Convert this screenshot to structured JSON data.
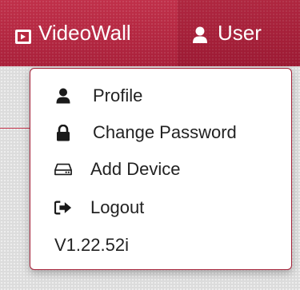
{
  "navbar": {
    "brand_label": "VideoWall",
    "brand_icon": "video-icon",
    "user_label": "User",
    "user_icon": "user-icon",
    "accent_color": "#b72a40"
  },
  "user_menu": {
    "items": [
      {
        "label": "Profile",
        "icon": "user-icon"
      },
      {
        "label": "Change Password",
        "icon": "lock-icon"
      },
      {
        "label": "Add Device",
        "icon": "hard-drive-icon"
      },
      {
        "label": "Logout",
        "icon": "sign-out-icon"
      }
    ],
    "version": "V1.22.52i"
  }
}
